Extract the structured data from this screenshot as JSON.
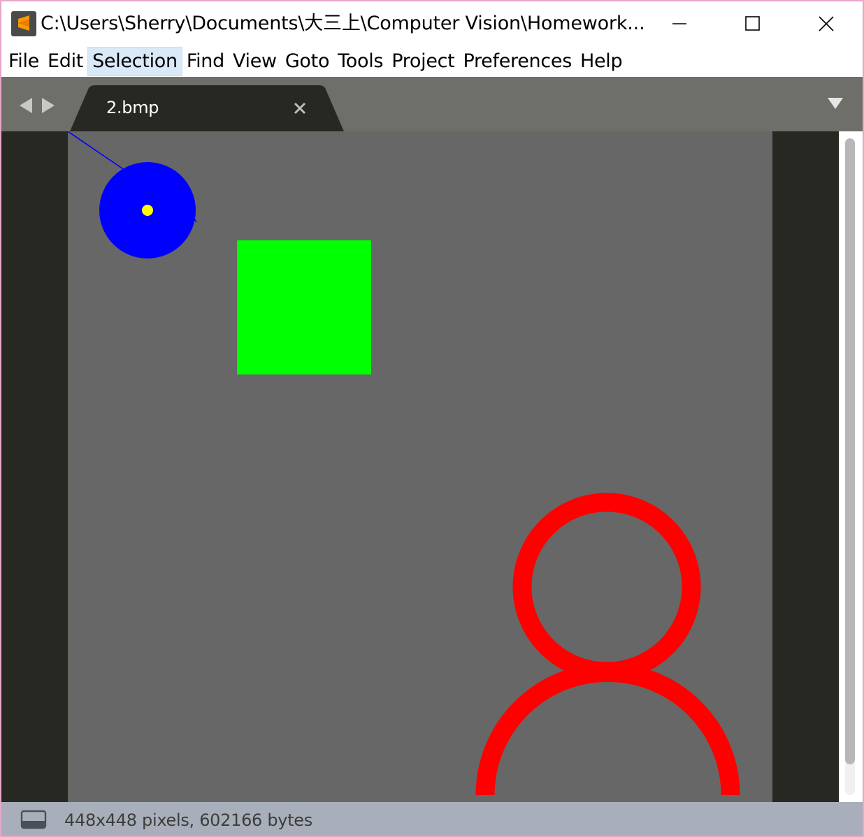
{
  "window": {
    "title": "C:\\Users\\Sherry\\Documents\\大三上\\Computer Vision\\Homework..."
  },
  "menu": {
    "items": [
      "File",
      "Edit",
      "Selection",
      "Find",
      "View",
      "Goto",
      "Tools",
      "Project",
      "Preferences",
      "Help"
    ],
    "active": "Selection"
  },
  "tabs": [
    {
      "label": "2.bmp",
      "active": true
    }
  ],
  "status": {
    "text": "448x448 pixels, 602166 bytes"
  },
  "image": {
    "shapes": [
      {
        "kind": "circle",
        "fill": "#0000ff",
        "marker": "#ffff00"
      },
      {
        "kind": "square",
        "fill": "#00ff00"
      },
      {
        "kind": "person-outline",
        "stroke": "#ff0000"
      }
    ]
  },
  "colors": {
    "tab_bar": "#6f6f6a",
    "editor_bg": "#272822",
    "image_bg": "#676767",
    "status_bar": "#a9afba",
    "menu_highlight": "#d9e9f7"
  },
  "icons": {
    "app": "sublime-text-icon",
    "minimize": "minimize-icon",
    "maximize": "maximize-icon",
    "close": "close-icon",
    "back": "arrow-left-icon",
    "forward": "arrow-right-icon",
    "tab_close": "tab-close-icon",
    "tab_list": "chevron-down-icon",
    "status_panel": "panel-icon"
  }
}
